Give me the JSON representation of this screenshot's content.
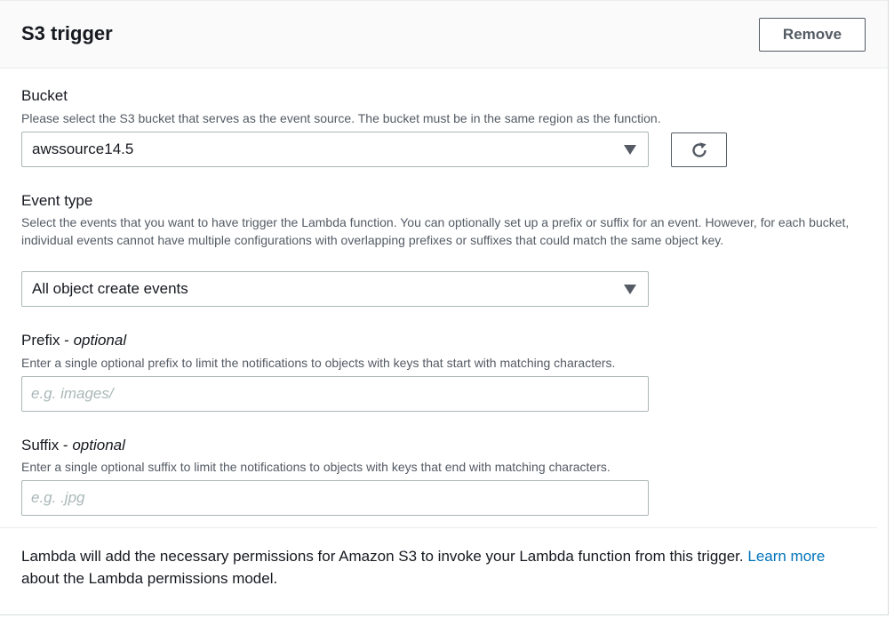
{
  "panel": {
    "title": "S3 trigger",
    "remove_label": "Remove"
  },
  "bucket": {
    "label": "Bucket",
    "description": "Please select the S3 bucket that serves as the event source. The bucket must be in the same region as the function.",
    "selected": "awssource14.5",
    "refresh_icon": "refresh-icon"
  },
  "event_type": {
    "label": "Event type",
    "description": "Select the events that you want to have trigger the Lambda function. You can optionally set up a prefix or suffix for an event. However, for each bucket, individual events cannot have multiple configurations with overlapping prefixes or suffixes that could match the same object key.",
    "selected": "All object create events"
  },
  "prefix": {
    "label": "Prefix - ",
    "optional": "optional",
    "description": "Enter a single optional prefix to limit the notifications to objects with keys that start with matching characters.",
    "value": "",
    "placeholder": "e.g. images/"
  },
  "suffix": {
    "label": "Suffix - ",
    "optional": "optional",
    "description": "Enter a single optional suffix to limit the notifications to objects with keys that end with matching characters.",
    "value": "",
    "placeholder": "e.g. .jpg"
  },
  "footer": {
    "text_before": "Lambda will add the necessary permissions for Amazon S3 to invoke your Lambda function from this trigger. ",
    "link": "Learn more",
    "text_after": " about the Lambda permissions model."
  },
  "colors": {
    "link": "#0073bb",
    "border": "#aab7b8",
    "text_secondary": "#545b64"
  }
}
